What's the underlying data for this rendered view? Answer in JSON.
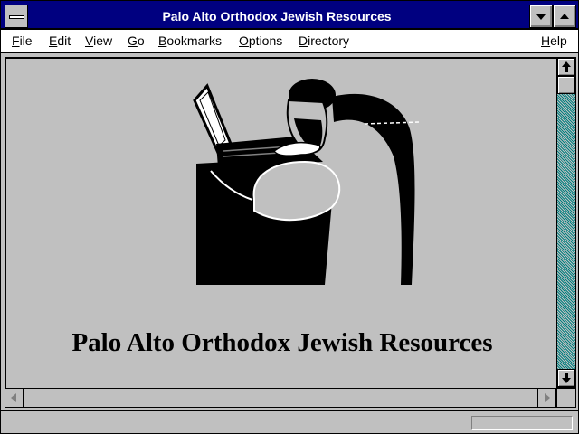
{
  "window": {
    "title": "Palo Alto Orthodox Jewish Resources"
  },
  "menubar": {
    "items": [
      {
        "label": "File",
        "u": "F",
        "rest": "ile"
      },
      {
        "label": "Edit",
        "u": "E",
        "rest": "dit"
      },
      {
        "label": "View",
        "u": "V",
        "rest": "iew"
      },
      {
        "label": "Go",
        "u": "G",
        "rest": "o"
      },
      {
        "label": "Bookmarks",
        "u": "B",
        "rest": "ookmarks"
      },
      {
        "label": "Options",
        "u": "O",
        "rest": "ptions"
      },
      {
        "label": "Directory",
        "u": "D",
        "rest": "irectory"
      },
      {
        "label": "Help",
        "u": "H",
        "rest": "elp"
      }
    ]
  },
  "content": {
    "heading": "Palo Alto Orthodox Jewish Resources",
    "illustration_icon": "man-at-laptop-illustration"
  },
  "statusbar": {
    "text": "",
    "progress": 0
  },
  "colors": {
    "titlebar": "#000080",
    "chrome": "#c0c0c0",
    "scroll_track": "#008080"
  }
}
